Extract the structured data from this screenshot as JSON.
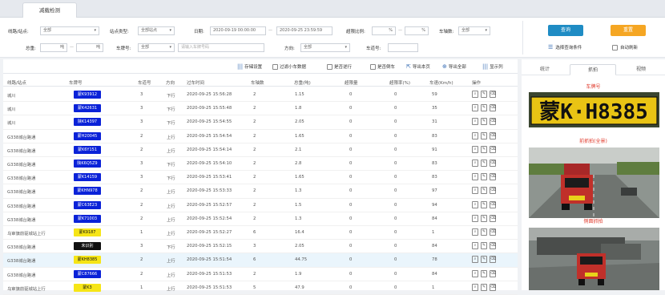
{
  "top": {
    "tab": "减载检测"
  },
  "filter": {
    "line_station_label": "线路/站点:",
    "line_station_value": "全部",
    "station_type_label": "站点类型:",
    "station_type_value": "全部站点",
    "date_label": "日期:",
    "date_start": "2020-09-19 00:00:00",
    "date_end": "2020-09-25 23:59:59",
    "overload_label": "超限比例:",
    "overload_unit1": "%",
    "overload_unit2": "%",
    "axle_label": "车轴数:",
    "axle_value": "全部",
    "weight_label": "总重:",
    "weight_unit1": "吨",
    "weight_unit2": "吨",
    "plate_label": "车牌号:",
    "plate_province": "全部",
    "plate_placeholder": "请输入车牌号码",
    "direction_label": "方向:",
    "direction_value": "全部",
    "lane_label": "车道号:",
    "query_button": "查询",
    "reset_button": "重置",
    "select_query_condition": "选择查询条件",
    "auto_refresh": "自动刷新"
  },
  "toolbar": {
    "storage_settings": "存储设置",
    "filter_small": "过滤小车数据",
    "is_reverse": "是否逆行",
    "is_retreat": "是否倒车",
    "export_page": "导出本页",
    "export_all": "导出全部",
    "show_columns": "显示列"
  },
  "table": {
    "headers": [
      "线路/站点",
      "车牌号",
      "车道号",
      "方向",
      "过车时间",
      "车轴数",
      "总重(吨)",
      "超限量",
      "超限率(%)",
      "车速(Km/h)",
      "操作"
    ],
    "rows": [
      {
        "station": "城川",
        "plate": "蒙K93912",
        "plate_color": "blue",
        "lane": "3",
        "dir": "下行",
        "time": "2020-09-25 15:56:28",
        "axles": "2",
        "weight": "1.15",
        "over": "0",
        "rate": "0",
        "speed": "59"
      },
      {
        "station": "城川",
        "plate": "蒙K42631",
        "plate_color": "blue",
        "lane": "3",
        "dir": "下行",
        "time": "2020-09-25 15:55:48",
        "axles": "2",
        "weight": "1.8",
        "over": "0",
        "rate": "0",
        "speed": "35"
      },
      {
        "station": "城川",
        "plate": "陕K14397",
        "plate_color": "blue",
        "lane": "3",
        "dir": "下行",
        "time": "2020-09-25 15:54:55",
        "axles": "2",
        "weight": "2.05",
        "over": "0",
        "rate": "0",
        "speed": "31"
      },
      {
        "station": "G338城台路通",
        "plate": "蒙H20045",
        "plate_color": "blue",
        "lane": "2",
        "dir": "上行",
        "time": "2020-09-25 15:54:54",
        "axles": "2",
        "weight": "1.65",
        "over": "0",
        "rate": "0",
        "speed": "83"
      },
      {
        "station": "G338城台路通",
        "plate": "蒙K6Y151",
        "plate_color": "blue",
        "lane": "2",
        "dir": "上行",
        "time": "2020-09-25 15:54:14",
        "axles": "2",
        "weight": "2.1",
        "over": "0",
        "rate": "0",
        "speed": "91"
      },
      {
        "station": "G338城台路通",
        "plate": "陕K6Q5Z9",
        "plate_color": "blue",
        "lane": "3",
        "dir": "下行",
        "time": "2020-09-25 15:54:10",
        "axles": "2",
        "weight": "2.8",
        "over": "0",
        "rate": "0",
        "speed": "83"
      },
      {
        "station": "G338城台路通",
        "plate": "蒙K14159",
        "plate_color": "blue",
        "lane": "3",
        "dir": "下行",
        "time": "2020-09-25 15:53:41",
        "axles": "2",
        "weight": "1.65",
        "over": "0",
        "rate": "0",
        "speed": "83"
      },
      {
        "station": "G338城台路通",
        "plate": "蒙KHN978",
        "plate_color": "blue",
        "lane": "2",
        "dir": "上行",
        "time": "2020-09-25 15:53:33",
        "axles": "2",
        "weight": "1.3",
        "over": "0",
        "rate": "0",
        "speed": "97"
      },
      {
        "station": "G338城台路通",
        "plate": "蒙C63E23",
        "plate_color": "blue",
        "lane": "2",
        "dir": "上行",
        "time": "2020-09-25 15:52:57",
        "axles": "2",
        "weight": "1.5",
        "over": "0",
        "rate": "0",
        "speed": "94"
      },
      {
        "station": "G338城台路通",
        "plate": "蒙K71003",
        "plate_color": "blue",
        "lane": "2",
        "dir": "上行",
        "time": "2020-09-25 15:52:54",
        "axles": "2",
        "weight": "1.3",
        "over": "0",
        "rate": "0",
        "speed": "84"
      },
      {
        "station": "乌审旗前驱城站上行",
        "plate": "蒙K9187",
        "plate_color": "yellow",
        "lane": "1",
        "dir": "上行",
        "time": "2020-09-25 15:52:27",
        "axles": "6",
        "weight": "16.4",
        "over": "0",
        "rate": "0",
        "speed": "1"
      },
      {
        "station": "G338城台路通",
        "plate": "未识别",
        "plate_color": "black",
        "lane": "3",
        "dir": "下行",
        "time": "2020-09-25 15:52:15",
        "axles": "3",
        "weight": "2.05",
        "over": "0",
        "rate": "0",
        "speed": "84"
      },
      {
        "station": "G338城台路通",
        "plate": "蒙KH8385",
        "plate_color": "yellow",
        "lane": "2",
        "dir": "上行",
        "time": "2020-09-25 15:51:54",
        "axles": "6",
        "weight": "44.75",
        "over": "0",
        "rate": "0",
        "speed": "78"
      },
      {
        "station": "G338城台路通",
        "plate": "蒙C87666",
        "plate_color": "blue",
        "lane": "2",
        "dir": "上行",
        "time": "2020-09-25 15:51:53",
        "axles": "2",
        "weight": "1.9",
        "over": "0",
        "rate": "0",
        "speed": "84"
      },
      {
        "station": "乌审旗前驱城站上行",
        "plate": "蒙K3",
        "plate_color": "yellow",
        "lane": "1",
        "dir": "上行",
        "time": "2020-09-25 15:51:53",
        "axles": "5",
        "weight": "47.9",
        "over": "0",
        "rate": "0",
        "speed": "1"
      }
    ]
  },
  "side": {
    "tabs": [
      "统计",
      "抓拍",
      "视频"
    ],
    "caption1": "车牌号",
    "plate_text": "蒙K·H8385",
    "caption2": "前抓拍(全景)",
    "caption3": "侧面抓拍"
  },
  "colors": {
    "accent_blue": "#1f8cc4",
    "reset_orange": "#f5a623",
    "plate_blue": "#0a22d8",
    "plate_yellow": "#f6e516",
    "selected_row": "#eaf5fc",
    "caption_red": "#e0392b"
  }
}
